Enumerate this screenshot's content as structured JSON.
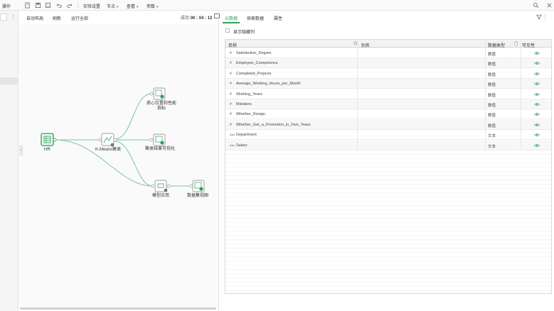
{
  "menubar": {
    "operations": "操作",
    "experiment_settings": "实验设置",
    "node_menu": "节点",
    "view_menu": "查看",
    "params_menu": "参数"
  },
  "canvas_toolbar": {
    "auto_layout": "自动布局",
    "refresh": "刷新",
    "run_all": "运行全部",
    "status_prefix": "成功",
    "status_time": "00 : 04 : 12"
  },
  "nodes": {
    "hr": "HR",
    "kmeans": "K-Means聚类",
    "centroid": "质心位置和性能指标",
    "cluster_viz": "聚类结果可视化",
    "model_apply": "模型应用",
    "data_view": "数据集视图"
  },
  "tabs": {
    "metadata": "元数据",
    "explore": "探索数据",
    "properties": "属性"
  },
  "show_hidden_label": "显示隐藏列",
  "table": {
    "headers": {
      "name": "名称",
      "alias": "别名",
      "type": "数据类型",
      "visible": "可见性"
    },
    "rows": [
      {
        "kind": "#",
        "name": "Satisfaction_Degree",
        "type": "数值"
      },
      {
        "kind": "#",
        "name": "Employee_Competence",
        "type": "数值"
      },
      {
        "kind": "#",
        "name": "Completed_Projects",
        "type": "数值"
      },
      {
        "kind": "#",
        "name": "Average_Working_Hours_per_Month",
        "type": "数值"
      },
      {
        "kind": "#",
        "name": "Working_Years",
        "type": "数值"
      },
      {
        "kind": "#",
        "name": "Mistakes",
        "type": "数值"
      },
      {
        "kind": "#",
        "name": "Whether_Resign",
        "type": "数值"
      },
      {
        "kind": "#",
        "name": "Whether_Get_a_Promotion_in_Five_Years",
        "type": "数值"
      },
      {
        "kind": "Abc",
        "name": "Department",
        "type": "文本"
      },
      {
        "kind": "Abc",
        "name": "Salary",
        "type": "文本"
      }
    ]
  },
  "colors": {
    "accent": "#2f9e5a",
    "edge": "#7cc79a"
  }
}
